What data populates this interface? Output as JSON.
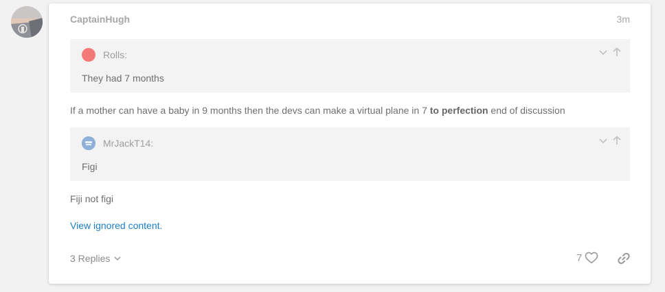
{
  "post": {
    "username": "CaptainHugh",
    "time": "3m",
    "quote1": {
      "author": "Rolls:",
      "text": "They had 7 months"
    },
    "paragraph1": {
      "before": "If a mother can have a baby in 9 months then the devs can make a virtual plane in 7 ",
      "bold": "to perfection",
      "after": " end of discussion"
    },
    "quote2": {
      "author": "MrJackT14:",
      "text": "Figi"
    },
    "paragraph2": "Fiji not figi",
    "ignored_link": "View ignored content.",
    "replies_label": "3 Replies",
    "like_count": "7"
  },
  "icons": {
    "avatar": "beach-sunset-avatar",
    "expand": "chevron-down-icon",
    "goto": "arrow-up-icon",
    "like": "heart-icon",
    "share": "link-icon",
    "replies_toggle": "chevron-down-icon"
  },
  "colors": {
    "accent_link": "#1b7ec2",
    "quote_bg": "#f3f3f3",
    "rolls_avatar": "#f47a7a"
  }
}
